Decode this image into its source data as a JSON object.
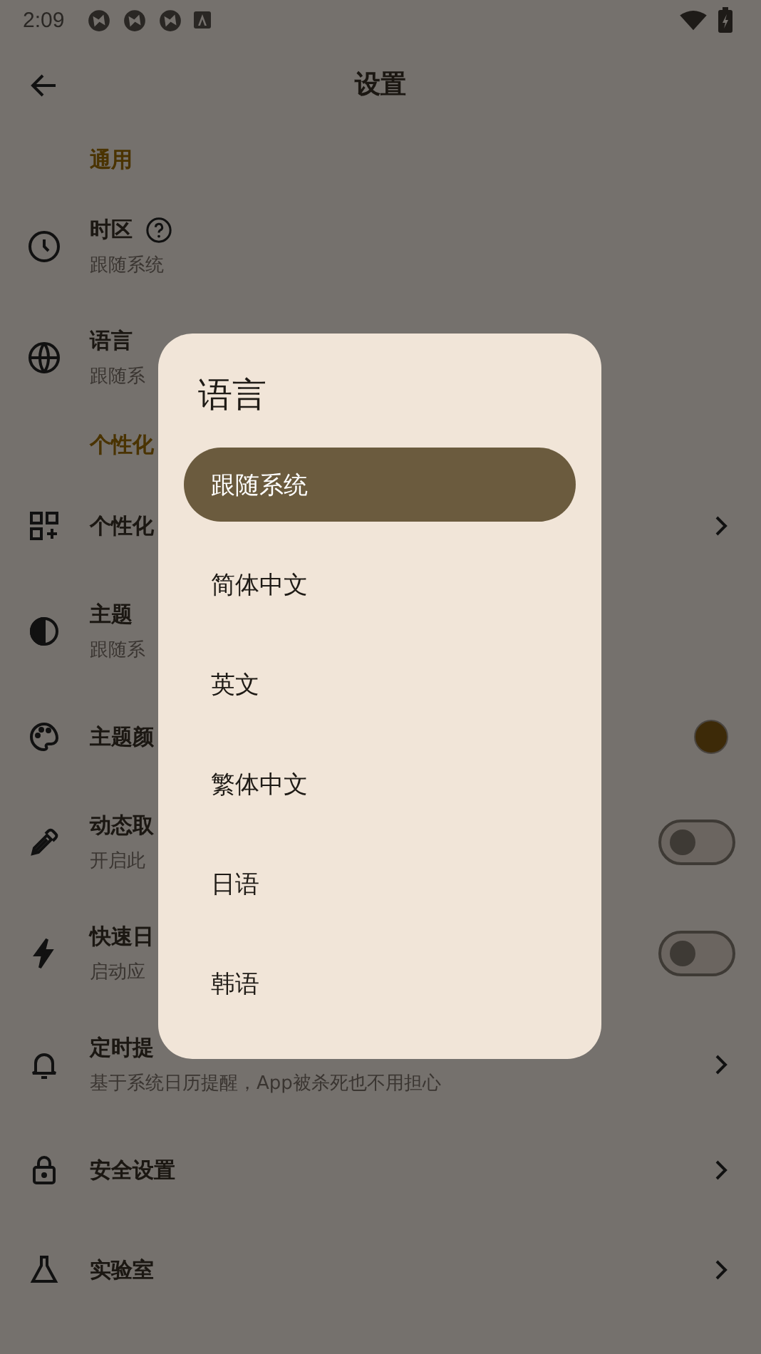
{
  "status_bar": {
    "time": "2:09"
  },
  "app_bar": {
    "title": "设置"
  },
  "items": [
    {
      "kind": "section",
      "title": "通用"
    },
    {
      "kind": "plain",
      "title": "时区",
      "subtitle": "跟随系统",
      "help": true
    },
    {
      "kind": "plain",
      "title": "语言",
      "subtitle": "跟随系"
    },
    {
      "kind": "section",
      "title": "个性化"
    },
    {
      "kind": "nav",
      "title": "个性化"
    },
    {
      "kind": "plain",
      "title": "主题",
      "subtitle": "跟随系"
    },
    {
      "kind": "color",
      "title": "主题颜",
      "color": "#3d2a08"
    },
    {
      "kind": "toggle",
      "title": "动态取",
      "subtitle": "开启此",
      "on": false
    },
    {
      "kind": "toggle",
      "title": "快速日",
      "subtitle": "启动应",
      "on": false
    },
    {
      "kind": "nav",
      "title": "定时提",
      "subtitle": "基于系统日历提醒，App被杀死也不用担心"
    },
    {
      "kind": "nav",
      "title": "安全设置"
    },
    {
      "kind": "nav",
      "title": "实验室"
    }
  ],
  "dialog": {
    "title": "语言",
    "options": [
      {
        "label": "跟随系统",
        "selected": true
      },
      {
        "label": "简体中文",
        "selected": false
      },
      {
        "label": "英文",
        "selected": false
      },
      {
        "label": "繁体中文",
        "selected": false
      },
      {
        "label": "日语",
        "selected": false
      },
      {
        "label": "韩语",
        "selected": false
      }
    ]
  }
}
